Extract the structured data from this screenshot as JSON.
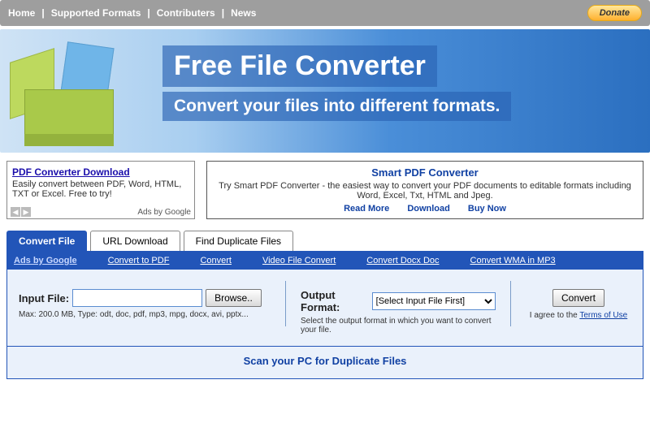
{
  "nav": {
    "items": [
      "Home",
      "Supported Formats",
      "Contributers",
      "News"
    ],
    "donate": "Donate"
  },
  "hero": {
    "title": "Free File Converter",
    "subtitle": "Convert your files into different formats."
  },
  "adLeft": {
    "title": "PDF Converter Download",
    "desc": "Easily convert between PDF, Word, HTML, TXT or Excel. Free to try!",
    "foot": "Ads by Google"
  },
  "adRight": {
    "title": "Smart PDF Converter",
    "desc": "Try Smart PDF Converter - the easiest way to convert your PDF documents to editable formats including Word, Excel, Txt, HTML and Jpeg.",
    "links": [
      "Read More",
      "Download",
      "Buy Now"
    ]
  },
  "tabs": [
    "Convert File",
    "URL Download",
    "Find Duplicate Files"
  ],
  "linkbar": [
    "Ads by Google",
    "Convert to PDF",
    "Convert",
    "Video File Convert",
    "Convert Docx Doc",
    "Convert WMA in MP3"
  ],
  "form": {
    "inputLabel": "Input File:",
    "browse": "Browse..",
    "inputHint": "Max: 200.0 MB, Type: odt, doc, pdf, mp3, mpg, docx, avi, pptx...",
    "outputLabel": "Output Format:",
    "selectPlaceholder": "[Select Input File First]",
    "outputHint": "Select the output format in which you want to convert your file.",
    "convert": "Convert",
    "agree": "I agree to the ",
    "terms": "Terms of Use"
  },
  "scan": "Scan your PC for Duplicate Files"
}
